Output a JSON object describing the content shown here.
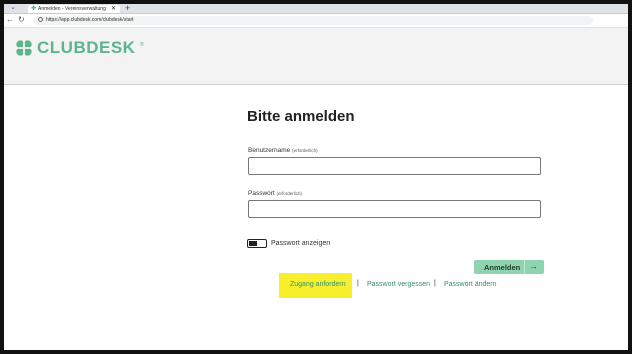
{
  "browser": {
    "tab_title": "Anmelden - Vereinsverwaltung - ...",
    "url": "https://app.clubdesk.com/clubdesk/start"
  },
  "brand": {
    "name": "CLUBDESK",
    "registered": "®",
    "color": "#5db48a"
  },
  "login": {
    "title": "Bitte anmelden",
    "username_label": "Benutzername",
    "username_required": "(erforderlich)",
    "username_value": "",
    "password_label": "Passwort",
    "password_required": "(erforderlich)",
    "password_value": "",
    "show_password_label": "Passwort anzeigen",
    "show_password_checked": false,
    "submit_label": "Anmelden",
    "submit_arrow": "→"
  },
  "links": {
    "request_access": "Zugang anfordern",
    "forgot_password": "Passwort vergessen",
    "change_password": "Passwort ändern",
    "separator": "|"
  },
  "colors": {
    "accent_button": "#8fd3b0",
    "link": "#3a8f6a",
    "highlight": "#f7ee2c"
  }
}
